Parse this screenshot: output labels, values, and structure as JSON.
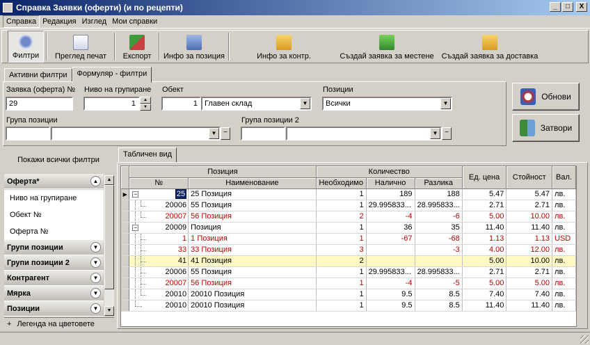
{
  "window": {
    "title": "Справка Заявки (оферти) (и по рецепти)",
    "minimize": "_",
    "maximize": "□",
    "close": "X"
  },
  "menu": [
    "Справка",
    "Редакция",
    "Изглед",
    "Мои справки"
  ],
  "toolbar": {
    "filters": "Филтри",
    "print_preview": "Преглед печат",
    "export": "Експорт",
    "position_info": "Инфо за позиция",
    "contractor_info": "Инфо за контр.",
    "create_local": "Създай заявка за местене",
    "create_delivery": "Създай заявка за доставка"
  },
  "colors": {
    "title_start": "#0a246a",
    "title_end": "#a6caf0",
    "red_text": "#c00000",
    "highlight": "#fdf8c4"
  },
  "tabs": [
    "Активни филтри",
    "Формуляр - филтри"
  ],
  "filters": {
    "order_label": "Заявка (оферта) №",
    "order_value": "29",
    "group_level_label": "Ниво на групиране",
    "group_level_value": "1",
    "object_label": "Обект",
    "object_num": "1",
    "object_name": "Главен склад",
    "positions_label": "Позиции",
    "positions_value": "Всички",
    "group_label": "Група позиции",
    "group_value": "",
    "group2_label": "Група позиции 2",
    "group2_value": ""
  },
  "buttons": {
    "refresh": "Обнови",
    "close": "Затвори"
  },
  "left": {
    "show_all": "Покажи всички филтри",
    "sections": [
      "Оферта*",
      "Групи позиции",
      "Групи позиции 2",
      "Контрагент",
      "Мярка",
      "Позиции"
    ],
    "sub_items": [
      "Ниво на групиране",
      "Обект №",
      "Оферта №"
    ],
    "legend": "Легенда на цветовете",
    "legend_plus": "+"
  },
  "grid": {
    "tab": "Табличен вид",
    "group_position": "Позиция",
    "group_quantity": "Количество",
    "columns": [
      "№",
      "Наименование",
      "Необходимо",
      "Налично",
      "Разлика",
      "Ед. цена",
      "Стойност",
      "Вал."
    ],
    "rows": [
      {
        "num": "25",
        "name": "25 Позиция",
        "need": "1",
        "avail": "189",
        "diff": "188",
        "price": "5.47",
        "value": "5.47",
        "cur": "лв."
      },
      {
        "num": "20006",
        "name": "55 Позиция",
        "need": "1",
        "avail": "29.995833...",
        "diff": "28.995833...",
        "price": "2.71",
        "value": "2.71",
        "cur": "лв."
      },
      {
        "num": "20007",
        "name": "56 Позиция",
        "need": "2",
        "avail": "-4",
        "diff": "-6",
        "price": "5.00",
        "value": "10.00",
        "cur": "лв."
      },
      {
        "num": "20009",
        "name": "Позиция",
        "need": "1",
        "avail": "36",
        "diff": "35",
        "price": "11.40",
        "value": "11.40",
        "cur": "лв."
      },
      {
        "num": "1",
        "name": "1 Позиция",
        "need": "1",
        "avail": "-67",
        "diff": "-68",
        "price": "1.13",
        "value": "1.13",
        "cur": "USD"
      },
      {
        "num": "33",
        "name": "33 Позиция",
        "need": "3",
        "avail": "",
        "diff": "-3",
        "price": "4.00",
        "value": "12.00",
        "cur": "лв."
      },
      {
        "num": "41",
        "name": "41 Позиция",
        "need": "2",
        "avail": "",
        "diff": "",
        "price": "5.00",
        "value": "10.00",
        "cur": "лв."
      },
      {
        "num": "20006",
        "name": "55 Позиция",
        "need": "1",
        "avail": "29.995833...",
        "diff": "28.995833...",
        "price": "2.71",
        "value": "2.71",
        "cur": "лв."
      },
      {
        "num": "20007",
        "name": "56 Позиция",
        "need": "1",
        "avail": "-4",
        "diff": "-5",
        "price": "5.00",
        "value": "5.00",
        "cur": "лв."
      },
      {
        "num": "20010",
        "name": "20010 Позиция",
        "need": "1",
        "avail": "9.5",
        "diff": "8.5",
        "price": "7.40",
        "value": "7.40",
        "cur": "лв."
      },
      {
        "num": "20010",
        "name": "20010 Позиция",
        "need": "1",
        "avail": "9.5",
        "diff": "8.5",
        "price": "11.40",
        "value": "11.40",
        "cur": "лв."
      }
    ]
  }
}
